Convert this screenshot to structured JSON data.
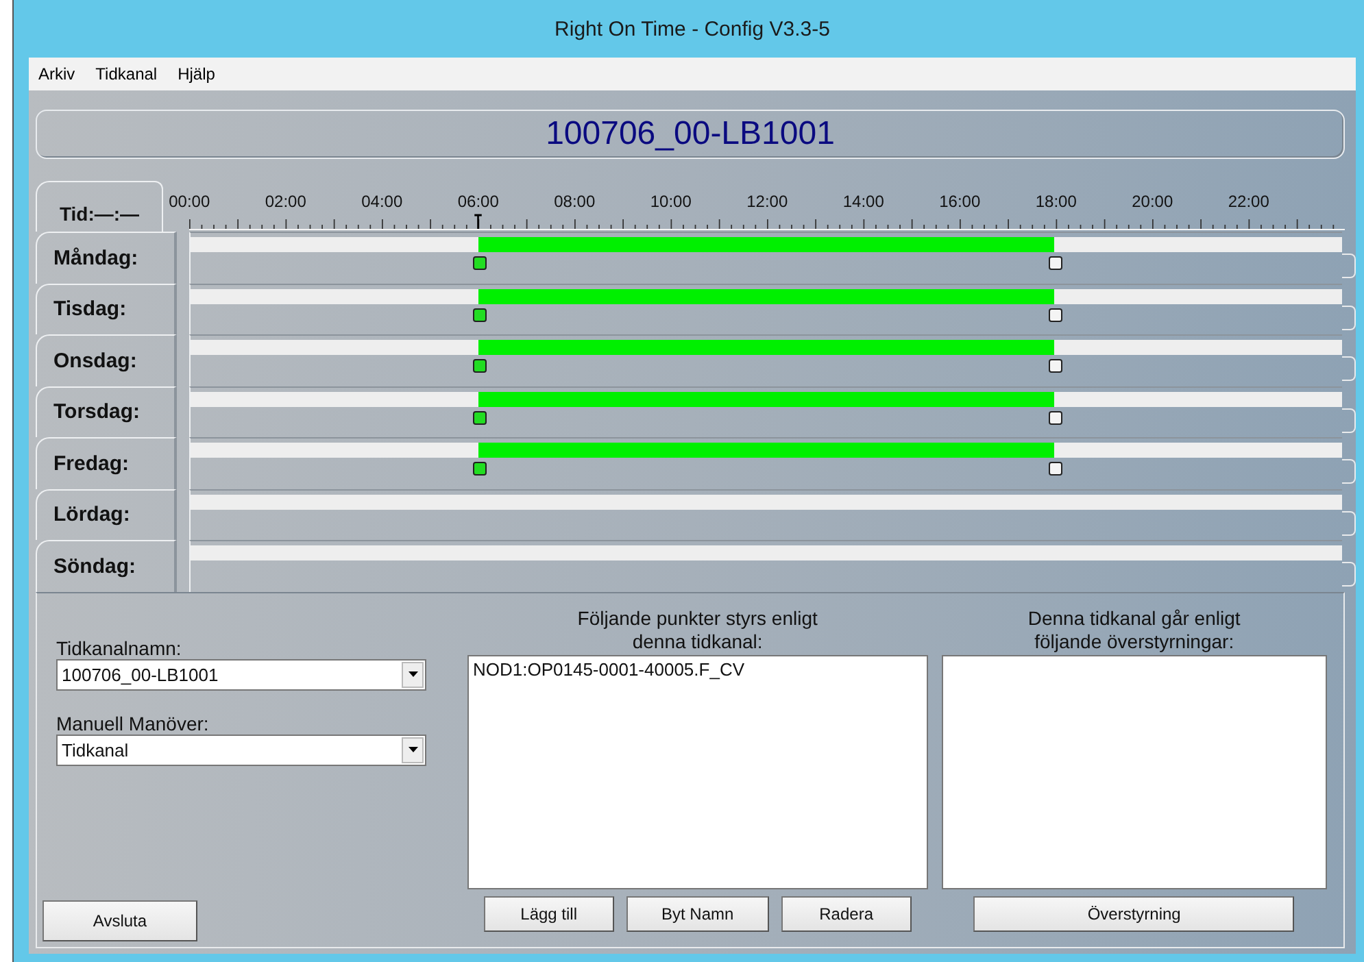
{
  "window": {
    "title": "Right On Time - Config V3.3-5"
  },
  "menu": [
    "Arkiv",
    "Tidkanal",
    "Hjälp"
  ],
  "channel_title": "100706_00-LB1001",
  "time_tab": "Tid:—:—",
  "timeline": {
    "hours": [
      "00:00",
      "02:00",
      "04:00",
      "06:00",
      "08:00",
      "10:00",
      "12:00",
      "14:00",
      "16:00",
      "18:00",
      "20:00",
      "22:00"
    ],
    "cursor": {
      "level": 0.25
    }
  },
  "days": [
    {
      "label": "Måndag:",
      "handles": [
        {
          "kind": "start",
          "level": 0.25
        },
        {
          "kind": "end",
          "level": 0.75
        }
      ]
    },
    {
      "label": "Tisdag:",
      "handles": [
        {
          "kind": "start",
          "level": 0.25
        },
        {
          "kind": "end",
          "level": 0.75
        }
      ]
    },
    {
      "label": "Onsdag:",
      "handles": [
        {
          "kind": "start",
          "level": 0.25
        },
        {
          "kind": "end",
          "level": 0.75
        }
      ]
    },
    {
      "label": "Torsdag:",
      "handles": [
        {
          "kind": "start",
          "level": 0.25
        },
        {
          "kind": "end",
          "level": 0.75
        }
      ]
    },
    {
      "label": "Fredag:",
      "handles": [
        {
          "kind": "start",
          "level": 0.25
        },
        {
          "kind": "end",
          "level": 0.75
        }
      ]
    },
    {
      "label": "Lördag:"
    },
    {
      "label": "Söndag:"
    }
  ],
  "form": {
    "name_label": "Tidkanalnamn:",
    "name_value": "100706_00-LB1001",
    "mode_label": "Manuell Manöver:",
    "mode_value": "Tidkanal"
  },
  "points": {
    "heading": "Följande punkter styrs enligt\ndenna tidkanal:",
    "items": [
      "NOD1:OP0145-0001-40005.F_CV"
    ],
    "buttons": [
      "Lägg till",
      "Byt Namn",
      "Radera"
    ]
  },
  "overrides": {
    "heading": "Denna tidkanal går enligt\nföljande överstyrningar:",
    "buttons": [
      "Överstyrning"
    ]
  },
  "exit_button": "Avsluta"
}
